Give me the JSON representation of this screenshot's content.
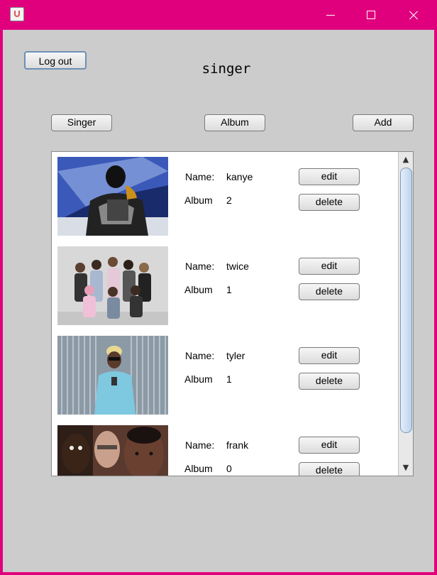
{
  "window": {
    "titlebar_color": "#e0007e",
    "icon": "java-cup-icon",
    "controls": [
      "minimize-icon",
      "maximize-icon",
      "close-icon"
    ]
  },
  "header": {
    "logout_label": "Log out",
    "title": "singer"
  },
  "nav": {
    "singer_label": "Singer",
    "album_label": "Album",
    "add_label": "Add"
  },
  "fields": {
    "name_label": "Name:",
    "album_label": "Album",
    "edit_label": "edit",
    "delete_label": "delete"
  },
  "singers": [
    {
      "name": "kanye",
      "albums": "2"
    },
    {
      "name": "twice",
      "albums": "1"
    },
    {
      "name": "tyler",
      "albums": "1"
    },
    {
      "name": "frank",
      "albums": "0"
    }
  ]
}
